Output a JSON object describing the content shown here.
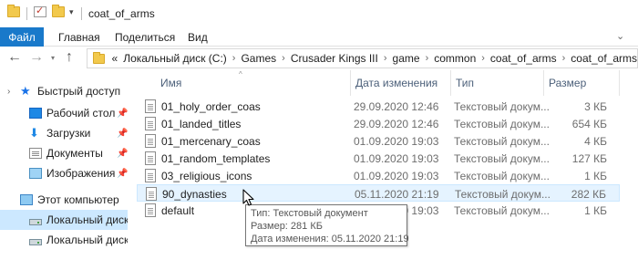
{
  "window": {
    "title": "coat_of_arms"
  },
  "ribbon": {
    "tabs": [
      "Файл",
      "Главная",
      "Поделиться",
      "Вид"
    ],
    "expand_icon": "chevron-down-icon"
  },
  "address_bar": {
    "overflow": "«",
    "crumbs": [
      "Локальный диск (C:)",
      "Games",
      "Crusader Kings III",
      "game",
      "common",
      "coat_of_arms",
      "coat_of_arms"
    ]
  },
  "nav_pane": {
    "quick_access": "Быстрый доступ",
    "items": [
      {
        "label": "Рабочий стол",
        "icon": "desktop-icon"
      },
      {
        "label": "Загрузки",
        "icon": "downloads-icon"
      },
      {
        "label": "Документы",
        "icon": "documents-icon"
      },
      {
        "label": "Изображения",
        "icon": "pictures-icon"
      }
    ],
    "this_pc": "Этот компьютер",
    "drives": [
      {
        "label": "Локальный диск (C",
        "selected": true
      },
      {
        "label": "Локальный диск (D",
        "selected": false
      }
    ]
  },
  "file_list": {
    "columns": [
      "Имя",
      "Дата изменения",
      "Тип",
      "Размер"
    ],
    "rows": [
      {
        "name": "01_holy_order_coas",
        "date": "29.09.2020 12:46",
        "type": "Текстовый докум...",
        "size": "3 КБ"
      },
      {
        "name": "01_landed_titles",
        "date": "29.09.2020 12:46",
        "type": "Текстовый докум...",
        "size": "654 КБ"
      },
      {
        "name": "01_mercenary_coas",
        "date": "01.09.2020 19:03",
        "type": "Текстовый докум...",
        "size": "4 КБ"
      },
      {
        "name": "01_random_templates",
        "date": "01.09.2020 19:03",
        "type": "Текстовый докум...",
        "size": "127 КБ"
      },
      {
        "name": "03_religious_icons",
        "date": "01.09.2020 19:03",
        "type": "Текстовый докум...",
        "size": "1 КБ"
      },
      {
        "name": "90_dynasties",
        "date": "05.11.2020 21:19",
        "type": "Текстовый докум...",
        "size": "282 КБ"
      },
      {
        "name": "default",
        "date": "01.09.2020 19:03",
        "type": "Текстовый докум...",
        "size": "1 КБ"
      }
    ]
  },
  "tooltip": {
    "lines": [
      "Тип: Текстовый документ",
      "Размер: 281 КБ",
      "Дата изменения: 05.11.2020 21:19"
    ]
  },
  "colors": {
    "accent": "#1979ca",
    "selection": "#cce8ff",
    "hover": "#e5f3ff",
    "header_text": "#4c607a"
  }
}
